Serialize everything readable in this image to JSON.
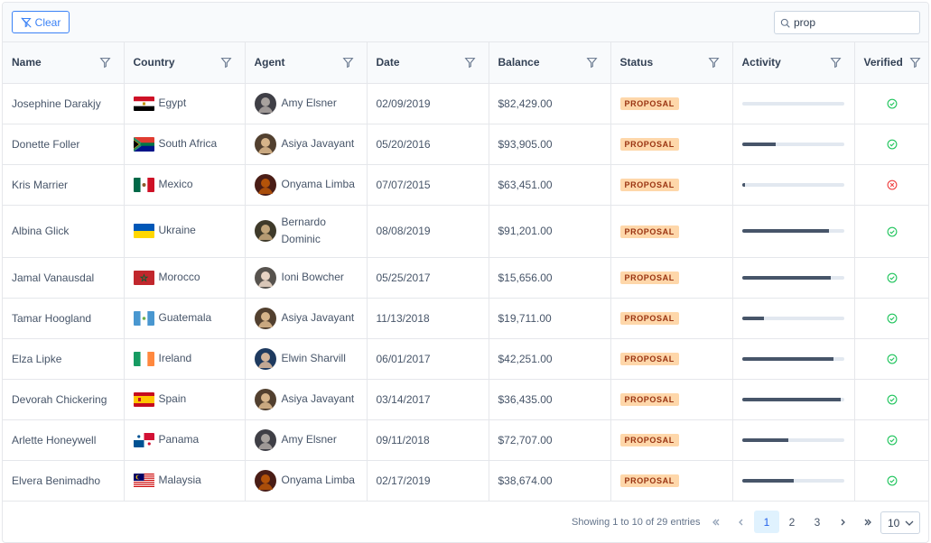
{
  "toolbar": {
    "clear_label": "Clear",
    "search_value": "prop"
  },
  "columns": [
    "Name",
    "Country",
    "Agent",
    "Date",
    "Balance",
    "Status",
    "Activity",
    "Verified"
  ],
  "rows": [
    {
      "name": "Josephine Darakjy",
      "country": "Egypt",
      "agent": "Amy Elsner",
      "date": "02/09/2019",
      "balance": "$82,429.00",
      "status": "PROPOSAL",
      "activity": 0,
      "verified": true
    },
    {
      "name": "Donette Foller",
      "country": "South Africa",
      "agent": "Asiya Javayant",
      "date": "05/20/2016",
      "balance": "$93,905.00",
      "status": "PROPOSAL",
      "activity": 33,
      "verified": true
    },
    {
      "name": "Kris Marrier",
      "country": "Mexico",
      "agent": "Onyama Limba",
      "date": "07/07/2015",
      "balance": "$63,451.00",
      "status": "PROPOSAL",
      "activity": 3,
      "verified": false
    },
    {
      "name": "Albina Glick",
      "country": "Ukraine",
      "agent": "Bernardo Dominic",
      "date": "08/08/2019",
      "balance": "$91,201.00",
      "status": "PROPOSAL",
      "activity": 85,
      "verified": true
    },
    {
      "name": "Jamal Vanausdal",
      "country": "Morocco",
      "agent": "Ioni Bowcher",
      "date": "05/25/2017",
      "balance": "$15,656.00",
      "status": "PROPOSAL",
      "activity": 87,
      "verified": true
    },
    {
      "name": "Tamar Hoogland",
      "country": "Guatemala",
      "agent": "Asiya Javayant",
      "date": "11/13/2018",
      "balance": "$19,711.00",
      "status": "PROPOSAL",
      "activity": 22,
      "verified": true
    },
    {
      "name": "Elza Lipke",
      "country": "Ireland",
      "agent": "Elwin Sharvill",
      "date": "06/01/2017",
      "balance": "$42,251.00",
      "status": "PROPOSAL",
      "activity": 90,
      "verified": true
    },
    {
      "name": "Devorah Chickering",
      "country": "Spain",
      "agent": "Asiya Javayant",
      "date": "03/14/2017",
      "balance": "$36,435.00",
      "status": "PROPOSAL",
      "activity": 97,
      "verified": true
    },
    {
      "name": "Arlette Honeywell",
      "country": "Panama",
      "agent": "Amy Elsner",
      "date": "09/11/2018",
      "balance": "$72,707.00",
      "status": "PROPOSAL",
      "activity": 46,
      "verified": true
    },
    {
      "name": "Elvera Benimadho",
      "country": "Malaysia",
      "agent": "Onyama Limba",
      "date": "02/17/2019",
      "balance": "$38,674.00",
      "status": "PROPOSAL",
      "activity": 51,
      "verified": true
    }
  ],
  "footer": {
    "showing_text": "Showing 1 to 10 of 29 entries",
    "pages": [
      "1",
      "2",
      "3"
    ],
    "current_page": "1",
    "page_size": "10"
  },
  "colors": {
    "accent": "#3b82f6",
    "verified": "#22c55e",
    "unverified": "#ef4444",
    "badge_bg": "#fed7aa",
    "badge_text": "#9a3412"
  }
}
